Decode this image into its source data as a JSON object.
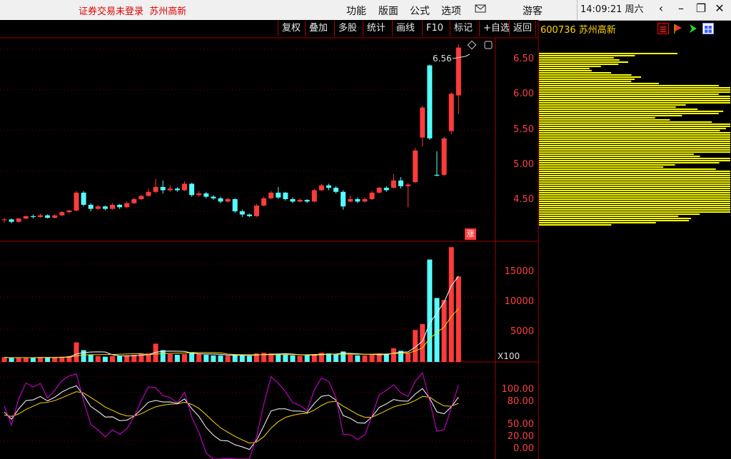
{
  "titlebar": {
    "login_status": "证券交易未登录",
    "stock_short": "苏州高新",
    "menus": [
      "功能",
      "版面",
      "公式",
      "选项"
    ],
    "mail_icon": "mail-icon",
    "user": "游客",
    "time": "14:09:21",
    "weekday": "周六"
  },
  "toolbar": {
    "buttons": [
      "复权",
      "叠加",
      "多股",
      "统计",
      "画线",
      "F10",
      "标记",
      "+自选",
      "返回"
    ],
    "code": "600736",
    "name": "苏州高新"
  },
  "colors": {
    "up": "#ff3b3b",
    "down": "#54ffff",
    "ma_white": "#ffffff",
    "ma_yellow": "#ffd800",
    "kdj_magenta": "#e000e0",
    "chip": "#ffff00"
  },
  "chart_data": [
    {
      "type": "candlestick",
      "y_ticks": [
        "6.50",
        "6.00",
        "5.50",
        "5.00",
        "4.50"
      ],
      "ylim": [
        4.13,
        6.64
      ],
      "high_label": "6.56",
      "change_badge": "涨",
      "candles": [
        [
          4.39,
          4.4,
          4.36,
          4.42
        ],
        [
          4.4,
          4.37,
          4.35,
          4.41
        ],
        [
          4.37,
          4.41,
          4.36,
          4.42
        ],
        [
          4.41,
          4.44,
          4.4,
          4.45
        ],
        [
          4.44,
          4.43,
          4.41,
          4.46
        ],
        [
          4.43,
          4.45,
          4.42,
          4.47
        ],
        [
          4.45,
          4.42,
          4.41,
          4.46
        ],
        [
          4.42,
          4.45,
          4.41,
          4.46
        ],
        [
          4.45,
          4.49,
          4.44,
          4.5
        ],
        [
          4.49,
          4.51,
          4.47,
          4.52
        ],
        [
          4.51,
          4.73,
          4.5,
          4.75
        ],
        [
          4.73,
          4.58,
          4.56,
          4.75
        ],
        [
          4.58,
          4.53,
          4.5,
          4.6
        ],
        [
          4.53,
          4.56,
          4.52,
          4.58
        ],
        [
          4.56,
          4.53,
          4.51,
          4.57
        ],
        [
          4.53,
          4.58,
          4.52,
          4.6
        ],
        [
          4.58,
          4.55,
          4.53,
          4.59
        ],
        [
          4.55,
          4.6,
          4.54,
          4.62
        ],
        [
          4.6,
          4.65,
          4.59,
          4.67
        ],
        [
          4.65,
          4.69,
          4.64,
          4.7
        ],
        [
          4.69,
          4.74,
          4.68,
          4.78
        ],
        [
          4.74,
          4.8,
          4.72,
          4.9
        ],
        [
          4.8,
          4.76,
          4.72,
          4.88
        ],
        [
          4.76,
          4.78,
          4.74,
          4.82
        ],
        [
          4.78,
          4.76,
          4.74,
          4.8
        ],
        [
          4.76,
          4.84,
          4.75,
          4.87
        ],
        [
          4.84,
          4.7,
          4.68,
          4.85
        ],
        [
          4.7,
          4.72,
          4.68,
          4.75
        ],
        [
          4.72,
          4.68,
          4.66,
          4.74
        ],
        [
          4.68,
          4.66,
          4.64,
          4.7
        ],
        [
          4.66,
          4.62,
          4.6,
          4.68
        ],
        [
          4.62,
          4.65,
          4.61,
          4.67
        ],
        [
          4.65,
          4.5,
          4.48,
          4.66
        ],
        [
          4.5,
          4.46,
          4.43,
          4.52
        ],
        [
          4.46,
          4.44,
          4.43,
          4.47
        ],
        [
          4.44,
          4.57,
          4.43,
          4.59
        ],
        [
          4.57,
          4.66,
          4.56,
          4.68
        ],
        [
          4.66,
          4.73,
          4.65,
          4.75
        ],
        [
          4.73,
          4.67,
          4.65,
          4.8
        ],
        [
          4.73,
          4.65,
          4.63,
          4.74
        ],
        [
          4.65,
          4.62,
          4.6,
          4.67
        ],
        [
          4.62,
          4.64,
          4.61,
          4.66
        ],
        [
          4.64,
          4.62,
          4.6,
          4.65
        ],
        [
          4.62,
          4.76,
          4.61,
          4.78
        ],
        [
          4.76,
          4.82,
          4.75,
          4.84
        ],
        [
          4.82,
          4.79,
          4.76,
          4.84
        ],
        [
          4.79,
          4.74,
          4.72,
          4.81
        ],
        [
          4.74,
          4.56,
          4.52,
          4.76
        ],
        [
          4.62,
          4.65,
          4.61,
          4.7
        ],
        [
          4.65,
          4.62,
          4.6,
          4.67
        ],
        [
          4.62,
          4.65,
          4.61,
          4.67
        ],
        [
          4.65,
          4.73,
          4.64,
          4.75
        ],
        [
          4.73,
          4.79,
          4.72,
          4.8
        ],
        [
          4.79,
          4.76,
          4.74,
          4.81
        ],
        [
          4.79,
          4.88,
          4.78,
          4.96
        ],
        [
          4.88,
          4.81,
          4.78,
          4.92
        ],
        [
          4.81,
          4.83,
          4.55,
          4.85
        ],
        [
          4.86,
          5.25,
          4.85,
          5.28
        ],
        [
          5.41,
          5.78,
          5.3,
          5.8
        ],
        [
          6.3,
          5.4,
          5.38,
          6.31
        ],
        [
          4.95,
          4.94,
          4.93,
          5.24
        ],
        [
          4.95,
          5.4,
          4.93,
          5.42
        ],
        [
          5.49,
          5.95,
          5.45,
          5.97
        ],
        [
          5.93,
          6.52,
          5.7,
          6.56
        ]
      ]
    },
    {
      "type": "bar",
      "name": "volume",
      "y_ticks": [
        "15000",
        "10000",
        "5000"
      ],
      "unit_label": "X100",
      "ylim": [
        0,
        18500
      ],
      "values": [
        700,
        600,
        650,
        700,
        650,
        750,
        700,
        650,
        800,
        900,
        3000,
        1800,
        1100,
        900,
        800,
        900,
        950,
        1000,
        1100,
        1200,
        1300,
        2800,
        1800,
        1200,
        1100,
        1200,
        1500,
        1200,
        1100,
        1000,
        1000,
        950,
        1100,
        1000,
        900,
        1300,
        1400,
        1300,
        1200,
        1100,
        1000,
        950,
        1000,
        1200,
        1400,
        1300,
        1200,
        1600,
        1100,
        1000,
        1000,
        1100,
        1300,
        1200,
        2100,
        1700,
        1400,
        4900,
        5800,
        15700,
        9800,
        9500,
        17600,
        13100
      ]
    },
    {
      "type": "line",
      "name": "kdj",
      "y_ticks": [
        "100.00",
        "80.00",
        "50.00",
        "20.00",
        "0.00"
      ],
      "ylim": [
        -3,
        118
      ]
    }
  ]
}
